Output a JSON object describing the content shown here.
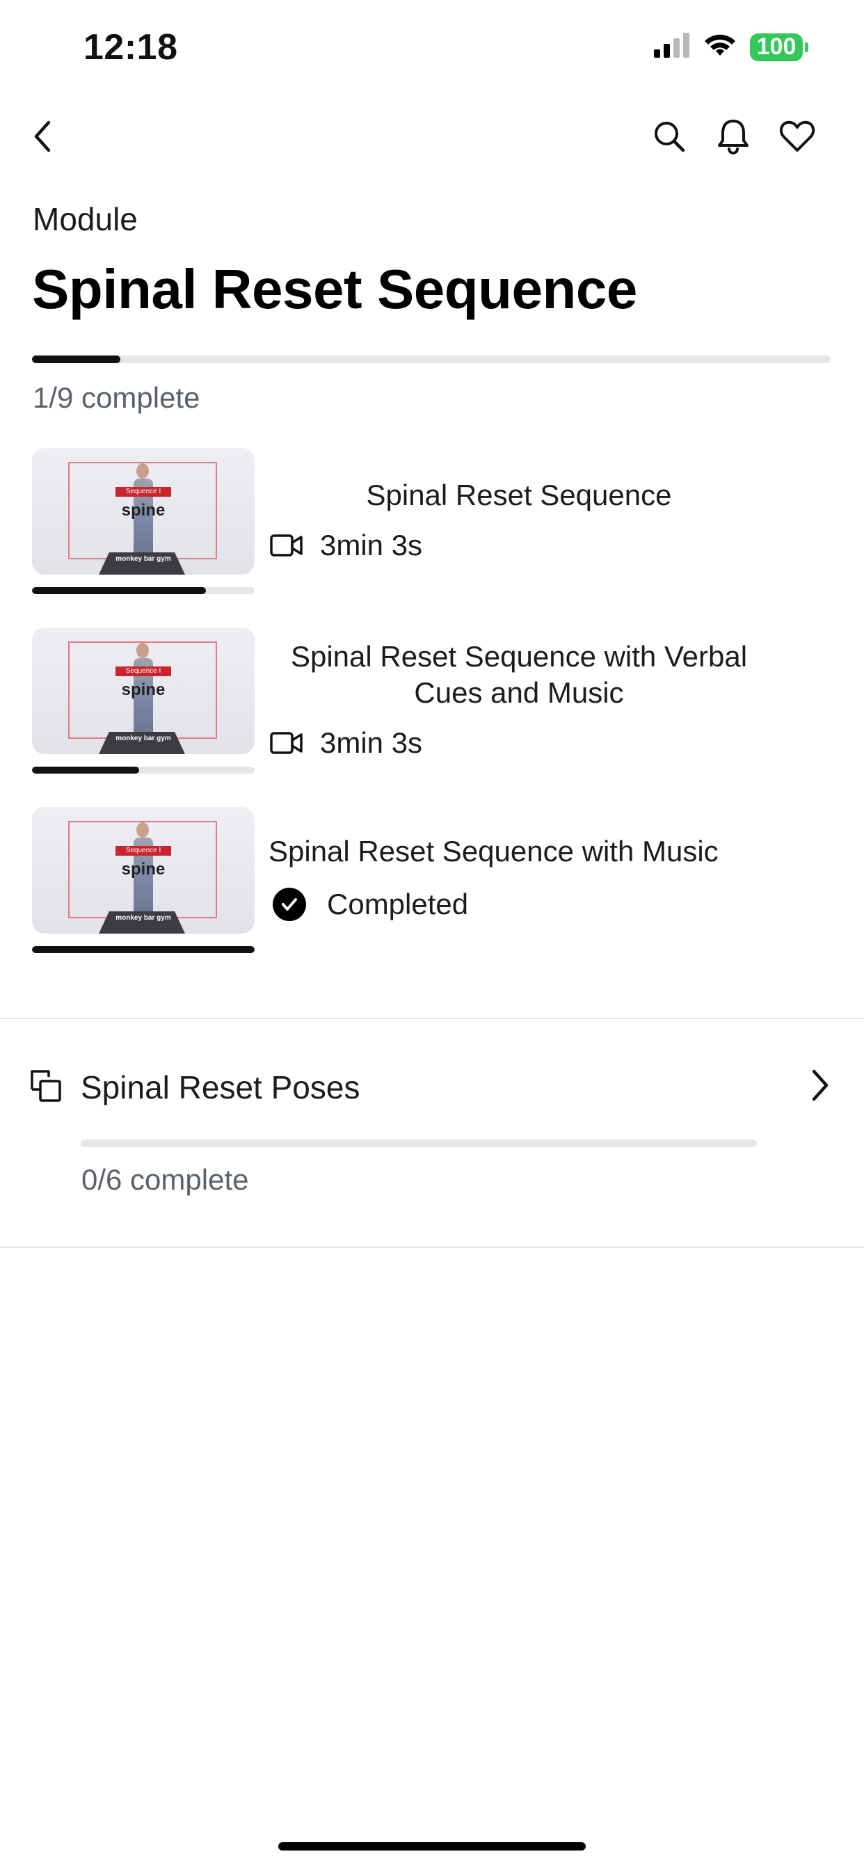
{
  "status_bar": {
    "time": "12:18",
    "battery": "100",
    "battery_color": "#34c759",
    "icons": [
      "cellular-signal-icon",
      "wifi-icon",
      "battery-icon"
    ]
  },
  "nav": {
    "icons": [
      "chevron-left-icon",
      "search-icon",
      "bell-icon",
      "heart-icon"
    ]
  },
  "module": {
    "label": "Module",
    "title": "Spinal Reset Sequence",
    "progress_text": "1/9 complete",
    "progress_fraction": 0.111
  },
  "lessons": [
    {
      "title": "Spinal Reset Sequence",
      "meta_icon": "video-camera-icon",
      "meta_text": "3min 3s",
      "progress_fraction": 0.78,
      "thumbnail": {
        "sequence": "Sequence I",
        "word": "spine",
        "brand": "monkey bar gym"
      }
    },
    {
      "title": "Spinal Reset Sequence with Verbal Cues and Music",
      "meta_icon": "video-camera-icon",
      "meta_text": "3min 3s",
      "progress_fraction": 0.48,
      "thumbnail": {
        "sequence": "Sequence I",
        "word": "spine",
        "brand": "monkey bar gym"
      }
    },
    {
      "title": "Spinal Reset Sequence with Music",
      "meta_icon": "checkmark-circle-icon",
      "meta_text": "Completed",
      "progress_fraction": 1.0,
      "thumbnail": {
        "sequence": "Sequence I",
        "word": "spine",
        "brand": "monkey bar gym"
      }
    }
  ],
  "submodule": {
    "icon": "nested-squares-icon",
    "title": "Spinal Reset Poses",
    "progress_text": "0/6 complete",
    "progress_fraction": 0.0,
    "chevron_icon": "chevron-right-icon"
  }
}
